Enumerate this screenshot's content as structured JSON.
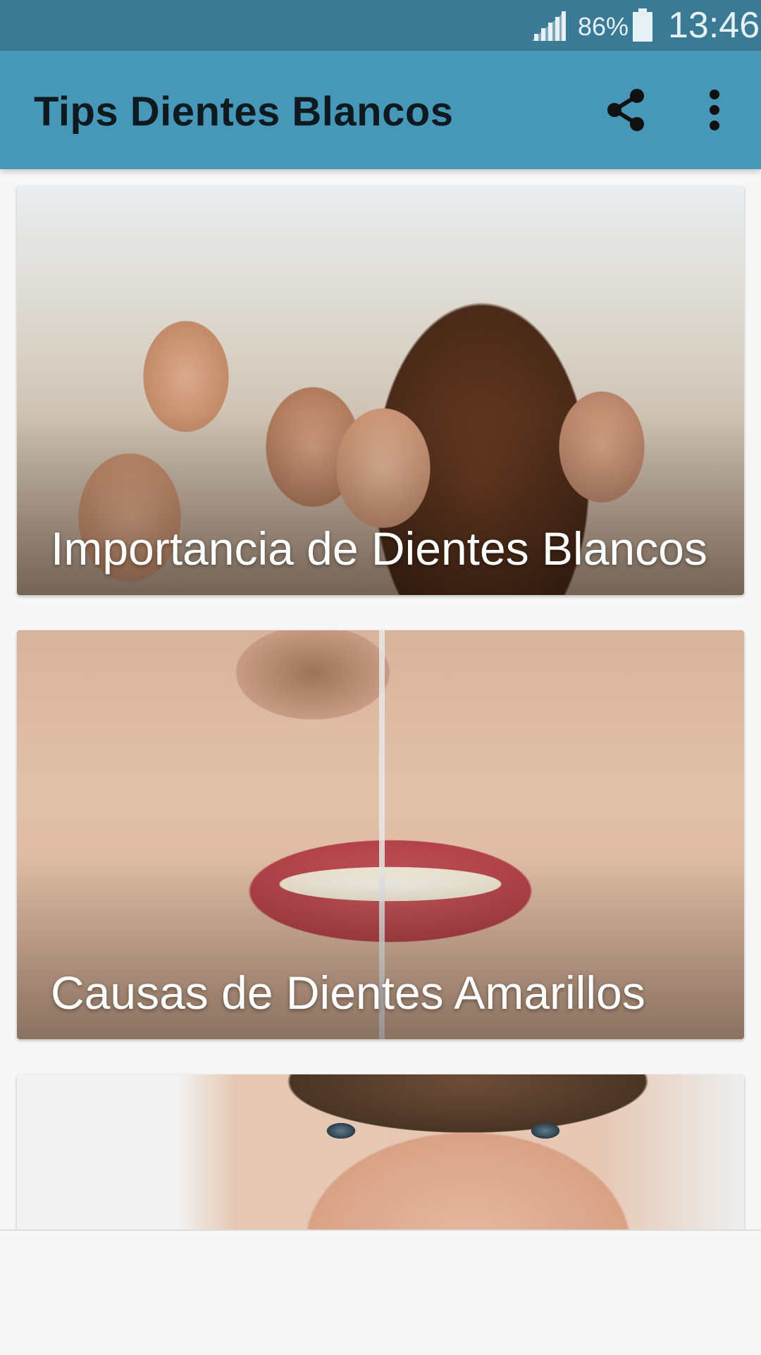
{
  "status_bar": {
    "battery_percent": "86%",
    "time": "13:46",
    "icons": [
      "signal-icon",
      "battery-icon"
    ]
  },
  "app_bar": {
    "title": "Tips Dientes Blancos",
    "actions": [
      "share-icon",
      "more-vert-icon"
    ]
  },
  "cards": [
    {
      "title": "Importancia de Dientes Blancos",
      "image": "group-smiling-selfie"
    },
    {
      "title": "Causas de Dientes Amarillos",
      "image": "white-vs-yellow-teeth"
    },
    {
      "title": "",
      "image": "man-face-eyes"
    }
  ],
  "colors": {
    "status_bar": "#3b7a94",
    "app_bar": "#4797b8",
    "background": "#f7f7f7"
  }
}
